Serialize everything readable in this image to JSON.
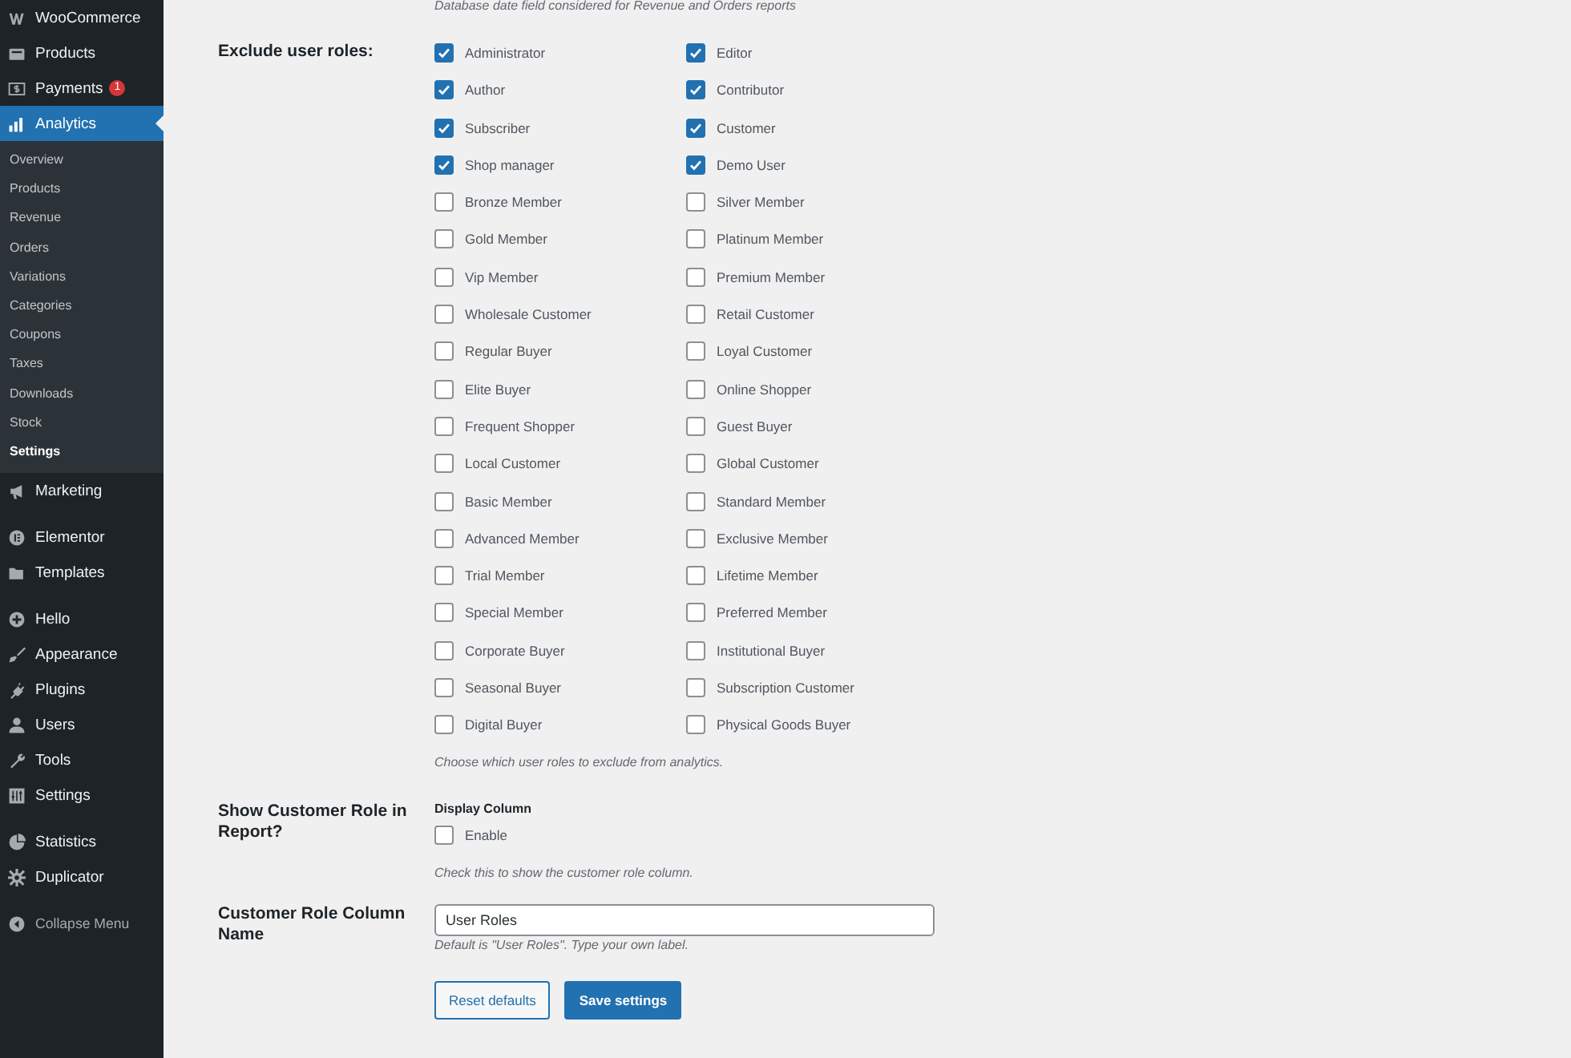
{
  "sidebar": {
    "groups": [
      {
        "items": [
          {
            "label": "WooCommerce",
            "selected": false
          },
          {
            "label": "Products",
            "selected": false
          },
          {
            "label": "Payments",
            "selected": false,
            "badge": "1"
          },
          {
            "label": "Analytics",
            "selected": true,
            "submenu": [
              {
                "label": "Overview",
                "selected": false
              },
              {
                "label": "Products",
                "selected": false
              },
              {
                "label": "Revenue",
                "selected": false
              },
              {
                "label": "Orders",
                "selected": false
              },
              {
                "label": "Variations",
                "selected": false
              },
              {
                "label": "Categories",
                "selected": false
              },
              {
                "label": "Coupons",
                "selected": false
              },
              {
                "label": "Taxes",
                "selected": false
              },
              {
                "label": "Downloads",
                "selected": false
              },
              {
                "label": "Stock",
                "selected": false
              },
              {
                "label": "Settings",
                "selected": true
              }
            ]
          },
          {
            "label": "Marketing",
            "selected": false
          }
        ]
      },
      {
        "items": [
          {
            "label": "Elementor",
            "selected": false
          },
          {
            "label": "Templates",
            "selected": false
          }
        ]
      },
      {
        "items": [
          {
            "label": "Hello",
            "selected": false
          },
          {
            "label": "Appearance",
            "selected": false
          },
          {
            "label": "Plugins",
            "selected": false
          },
          {
            "label": "Users",
            "selected": false
          },
          {
            "label": "Tools",
            "selected": false
          },
          {
            "label": "Settings",
            "selected": false
          }
        ]
      },
      {
        "items": [
          {
            "label": "Statistics",
            "selected": false
          },
          {
            "label": "Duplicator",
            "selected": false
          }
        ]
      }
    ],
    "collapse": "Collapse Menu"
  },
  "settings": {
    "top_description": "Database date field considered for Revenue and Orders reports",
    "exclude_roles": {
      "label": "Exclude user roles:",
      "roles": [
        {
          "label": "Administrator",
          "checked": true
        },
        {
          "label": "Editor",
          "checked": true
        },
        {
          "label": "Author",
          "checked": true
        },
        {
          "label": "Contributor",
          "checked": true
        },
        {
          "label": "Subscriber",
          "checked": true
        },
        {
          "label": "Customer",
          "checked": true
        },
        {
          "label": "Shop manager",
          "checked": true
        },
        {
          "label": "Demo User",
          "checked": true
        },
        {
          "label": "Bronze Member",
          "checked": false
        },
        {
          "label": "Silver Member",
          "checked": false
        },
        {
          "label": "Gold Member",
          "checked": false
        },
        {
          "label": "Platinum Member",
          "checked": false
        },
        {
          "label": "Vip Member",
          "checked": false
        },
        {
          "label": "Premium Member",
          "checked": false
        },
        {
          "label": "Wholesale Customer",
          "checked": false
        },
        {
          "label": "Retail Customer",
          "checked": false
        },
        {
          "label": "Regular Buyer",
          "checked": false
        },
        {
          "label": "Loyal Customer",
          "checked": false
        },
        {
          "label": "Elite Buyer",
          "checked": false
        },
        {
          "label": "Online Shopper",
          "checked": false
        },
        {
          "label": "Frequent Shopper",
          "checked": false
        },
        {
          "label": "Guest Buyer",
          "checked": false
        },
        {
          "label": "Local Customer",
          "checked": false
        },
        {
          "label": "Global Customer",
          "checked": false
        },
        {
          "label": "Basic Member",
          "checked": false
        },
        {
          "label": "Standard Member",
          "checked": false
        },
        {
          "label": "Advanced Member",
          "checked": false
        },
        {
          "label": "Exclusive Member",
          "checked": false
        },
        {
          "label": "Trial Member",
          "checked": false
        },
        {
          "label": "Lifetime Member",
          "checked": false
        },
        {
          "label": "Special Member",
          "checked": false
        },
        {
          "label": "Preferred Member",
          "checked": false
        },
        {
          "label": "Corporate Buyer",
          "checked": false
        },
        {
          "label": "Institutional Buyer",
          "checked": false
        },
        {
          "label": "Seasonal Buyer",
          "checked": false
        },
        {
          "label": "Subscription Customer",
          "checked": false
        },
        {
          "label": "Digital Buyer",
          "checked": false
        },
        {
          "label": "Physical Goods Buyer",
          "checked": false
        }
      ],
      "description": "Choose which user roles to exclude from analytics."
    },
    "show_role": {
      "label": "Show Customer Role in Report?",
      "heading": "Display Column",
      "option": {
        "label": "Enable",
        "checked": false
      },
      "description": "Check this to show the customer role column."
    },
    "column_name": {
      "label": "Customer Role Column Name",
      "value": "User Roles",
      "description": "Default is \"User Roles\". Type your own label."
    },
    "buttons": [
      {
        "label": "Reset defaults",
        "kind": "secondary"
      },
      {
        "label": "Save settings",
        "kind": "primary"
      }
    ]
  }
}
